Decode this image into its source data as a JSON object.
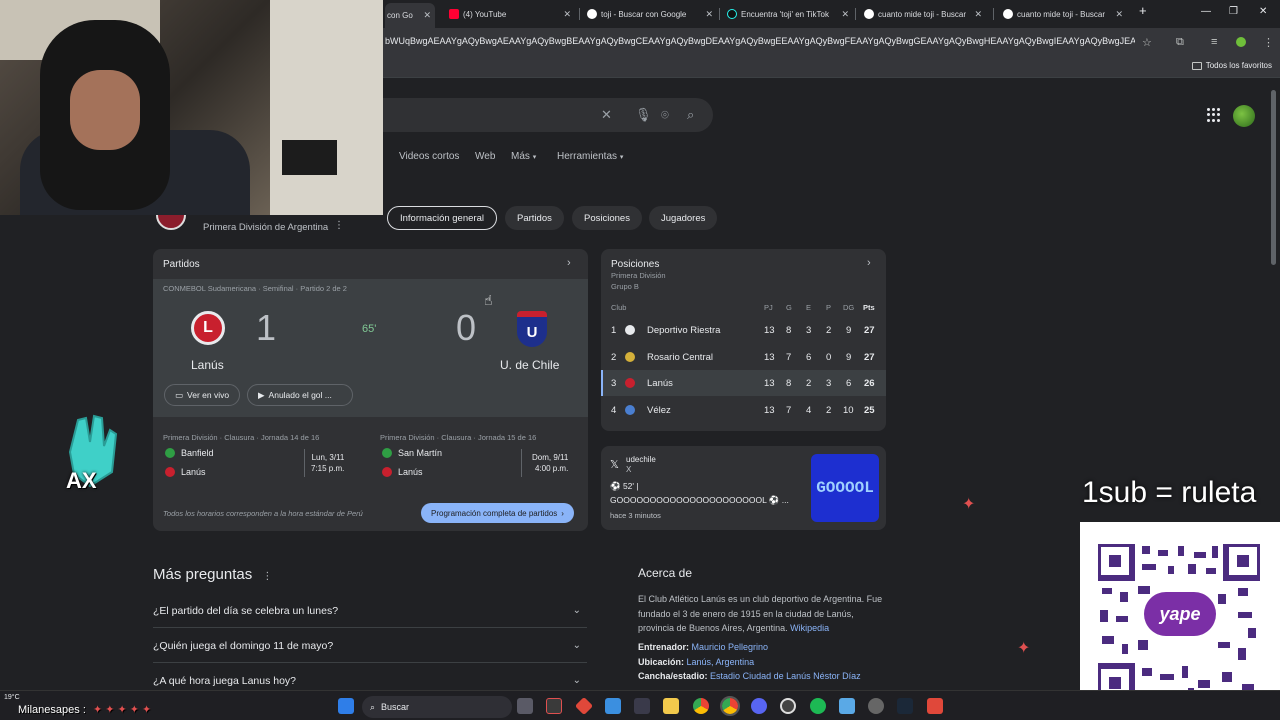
{
  "browser": {
    "tabs": [
      {
        "label": "con Go",
        "color": "#ffffff"
      },
      {
        "label": "(4) YouTube",
        "color": "#ff0033"
      },
      {
        "label": "toji - Buscar con Google",
        "color": "#ffffff"
      },
      {
        "label": "Encuentra 'toji' en TikTok",
        "color": "#25f4ee"
      },
      {
        "label": "cuanto mide toji - Buscar",
        "color": "#ffffff"
      },
      {
        "label": "cuanto mide toji - Buscar",
        "color": "#ffffff"
      }
    ],
    "url": "bWUqBwgAEAAYgAQyBwgAEAAYgAQyBwgBEAAYgAQyBwgCEAAYgAQyBwgDEAAYgAQyBwgEEAAYgAQyBwgFEAAYgAQyBwgGEAAYgAQyBwgHEAAYgAQyBwgIEAAYgAQyBwgJEAAYg...",
    "bookmarks_label": "Todos los favoritos"
  },
  "search": {
    "nav": [
      "Videos cortos",
      "Web",
      "Más",
      "Herramientas"
    ],
    "chips": [
      "Información general",
      "Partidos",
      "Posiciones",
      "Jugadores"
    ],
    "league": "Primera División de Argentina"
  },
  "partidos": {
    "title": "Partidos",
    "competition": "CONMEBOL Sudamericana · Semifinal · Partido 2 de 2",
    "home": {
      "name": "Lanús",
      "score": "1"
    },
    "away": {
      "name": "U. de Chile",
      "score": "0"
    },
    "minute": "65'",
    "btn_live": "Ver en vivo",
    "btn_goal": "Anulado el gol ...",
    "fixtures": [
      {
        "round": "Primera División · Clausura · Jornada 14 de 16",
        "team1": "Banfield",
        "team2": "Lanús",
        "date": "Lun, 3/11",
        "time": "7:15 p.m."
      },
      {
        "round": "Primera División · Clausura · Jornada 15 de 16",
        "team1": "San Martín",
        "team2": "Lanús",
        "date": "Dom, 9/11",
        "time": "4:00 p.m."
      }
    ],
    "footnote": "Todos los horarios corresponden a la hora estándar de Perú",
    "full_schedule": "Programación completa de partidos"
  },
  "posiciones": {
    "title": "Posiciones",
    "subtitle1": "Primera División",
    "subtitle2": "Grupo B",
    "headers": {
      "club": "Club",
      "pj": "PJ",
      "g": "G",
      "e": "E",
      "p": "P",
      "dg": "DG",
      "pts": "Pts"
    },
    "rows": [
      {
        "pos": "1",
        "club": "Deportivo Riestra",
        "pj": "13",
        "g": "8",
        "e": "3",
        "p": "2",
        "dg": "9",
        "pts": "27",
        "color": "#e8eaed"
      },
      {
        "pos": "2",
        "club": "Rosario Central",
        "pj": "13",
        "g": "7",
        "e": "6",
        "p": "0",
        "dg": "9",
        "pts": "27",
        "color": "#d4b03a"
      },
      {
        "pos": "3",
        "club": "Lanús",
        "pj": "13",
        "g": "8",
        "e": "2",
        "p": "3",
        "dg": "6",
        "pts": "26",
        "color": "#c8202e"
      },
      {
        "pos": "4",
        "club": "Vélez",
        "pj": "13",
        "g": "7",
        "e": "4",
        "p": "2",
        "dg": "10",
        "pts": "25",
        "color": "#4a7fd1"
      }
    ]
  },
  "tweet": {
    "account": "udechile",
    "platform": "X",
    "line1": "52' |",
    "line2": "GOOOOOOOOOOOOOOOOOOOOOOL",
    "time": "hace 3 minutos",
    "image_text": "GOOOOL"
  },
  "faq": {
    "title": "Más preguntas",
    "questions": [
      "¿El partido del día se celebra un lunes?",
      "¿Quién juega el domingo 11 de mayo?",
      "¿A qué hora juega Lanus hoy?"
    ]
  },
  "about": {
    "title": "Acerca de",
    "text": "El Club Atlético Lanús es un club deportivo de Argentina. Fue fundado el 3 de enero de 1915 en la ciudad de Lanús, provincia de Buenos Aires, Argentina.",
    "source": "Wikipedia",
    "facts": [
      {
        "label": "Entrenador:",
        "value": "Mauricio Pellegrino"
      },
      {
        "label": "Ubicación:",
        "value": "Lanús, Argentina"
      },
      {
        "label": "Cancha/estadio:",
        "value": "Estadio Ciudad de Lanús Néstor Díaz"
      }
    ]
  },
  "stream": {
    "ax_label": "AX",
    "sub_text": "1sub = ruleta",
    "yape_label": "yape",
    "chat_name": "Milanesapes :"
  },
  "taskbar": {
    "weather": "19°C",
    "search_label": "Buscar"
  }
}
